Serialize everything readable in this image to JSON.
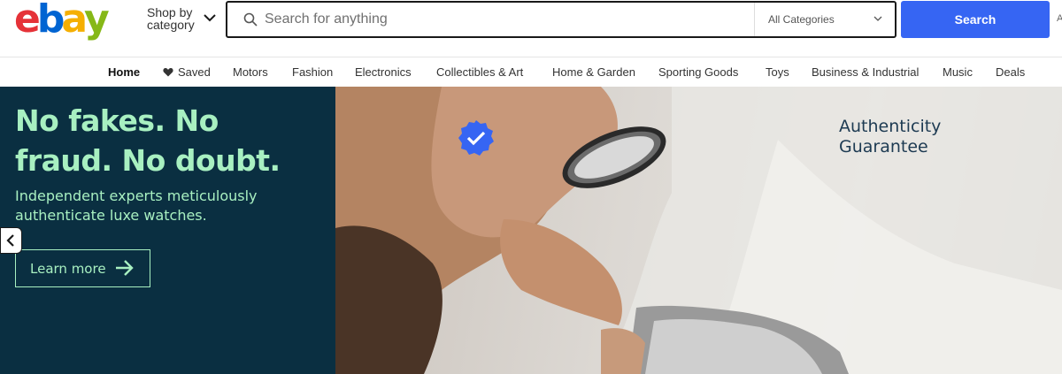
{
  "header": {
    "logo_letters": [
      "e",
      "b",
      "a",
      "y"
    ],
    "logo_colors": [
      "#e53238",
      "#0064d2",
      "#f5af02",
      "#86b817"
    ],
    "shop_by_line1": "Shop by",
    "shop_by_line2": "category",
    "search_placeholder": "Search for anything",
    "category_selected": "All Categories",
    "search_button": "Search",
    "advanced_label": "A"
  },
  "nav": {
    "items": [
      {
        "label": "Home",
        "active": true
      },
      {
        "label": "Saved",
        "icon": "heart-icon"
      },
      {
        "label": "Motors"
      },
      {
        "label": "Fashion"
      },
      {
        "label": "Electronics"
      },
      {
        "label": "Collectibles & Art"
      },
      {
        "label": "Home & Garden"
      },
      {
        "label": "Sporting Goods"
      },
      {
        "label": "Toys"
      },
      {
        "label": "Business & Industrial"
      },
      {
        "label": "Music"
      },
      {
        "label": "Deals"
      }
    ]
  },
  "hero": {
    "headline": "No fakes. No fraud. No doubt.",
    "subtext": "Independent experts meticulously authenticate luxe watches.",
    "cta_label": "Learn more",
    "badge_line1": "Authenticity",
    "badge_line2": "Guarantee",
    "accent_color": "#a8f0c1",
    "panel_color": "#0a2f41",
    "badge_color": "#3665f3"
  }
}
